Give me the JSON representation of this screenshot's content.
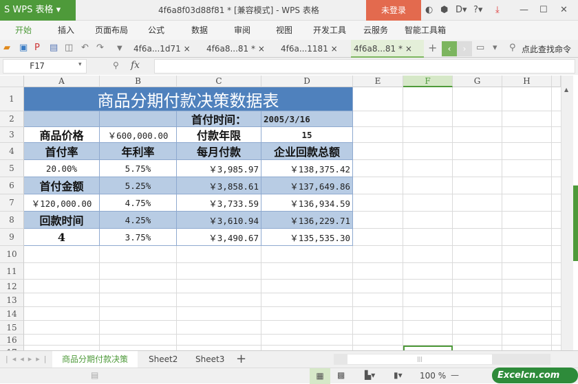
{
  "app": {
    "logo": "S WPS 表格 ▾",
    "title": "4f6a8f03d88f81 * [兼容模式] - WPS 表格",
    "login": "未登录"
  },
  "menu": [
    "开始",
    "插入",
    "页面布局",
    "公式",
    "数据",
    "审阅",
    "视图",
    "开发工具",
    "云服务",
    "智能工具箱"
  ],
  "doc_tabs": [
    {
      "label": "4f6a...1d71 ×"
    },
    {
      "label": "4f6a8...81 * ×"
    },
    {
      "label": "4f6a...1181 ×"
    },
    {
      "label": "4f6a8...81 * ×"
    }
  ],
  "search_cmd": "点此查找命令",
  "formula": {
    "namebox": "F17",
    "fx": "fx",
    "value": ""
  },
  "columns": [
    "A",
    "B",
    "C",
    "D",
    "E",
    "F",
    "G",
    "H"
  ],
  "rows": [
    "1",
    "2",
    "3",
    "4",
    "5",
    "6",
    "7",
    "8",
    "9",
    "10",
    "11",
    "12",
    "13",
    "14",
    "15",
    "16",
    "17"
  ],
  "cells": {
    "title": "商品分期付款决策数据表",
    "first_pay_time_label": "首付时间：",
    "first_pay_time": "2005/3/16",
    "price_label": "商品价格",
    "price": "￥600,000.00",
    "years_label": "付款年限",
    "years": "15",
    "h_rate": "首付率",
    "h_interest": "年利率",
    "h_monthly": "每月付款",
    "h_total": "企业回款总额",
    "down_rate": "20.00%",
    "down_amount_label": "首付金额",
    "down_amount": "￥120,000.00",
    "return_label": "回款时间",
    "return_value": "4",
    "interest": [
      "5.75%",
      "5.25%",
      "4.75%",
      "4.25%",
      "3.75%"
    ],
    "monthly": [
      "￥3,985.97",
      "￥3,858.61",
      "￥3,733.59",
      "￥3,610.94",
      "￥3,490.67"
    ],
    "total": [
      "￥138,375.42",
      "￥137,649.86",
      "￥136,934.59",
      "￥136,229.71",
      "￥135,535.30"
    ]
  },
  "sheets": [
    {
      "label": "商品分期付款决策"
    },
    {
      "label": "Sheet2"
    },
    {
      "label": "Sheet3"
    }
  ],
  "add_sheet": "+",
  "zoom": "100 %",
  "watermark": "Excelcn.com",
  "colors": {
    "accent": "#4e9a3a",
    "title_fill": "#4f81bd",
    "band_fill": "#b8cce4",
    "login": "#e36a4e"
  }
}
